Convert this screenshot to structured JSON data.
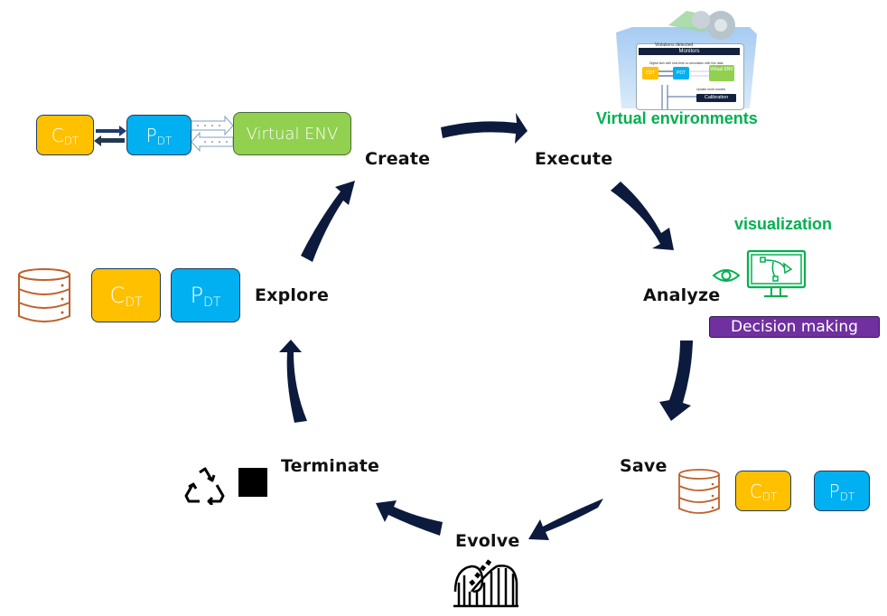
{
  "diagram": {
    "stages": {
      "create": "Create",
      "execute": "Execute",
      "analyze": "Analyze",
      "save": "Save",
      "evolve": "Evolve",
      "terminate": "Terminate",
      "explore": "Explore"
    },
    "create_group": {
      "c_dt": {
        "main": "C",
        "sub": "DT"
      },
      "p_dt": {
        "main": "P",
        "sub": "DT"
      },
      "virtual_env": "Virtual ENV"
    },
    "virtual_environments": {
      "title": "Virtual environments",
      "thumbnail": {
        "violations": "Violations detected",
        "monitors": "Monitors",
        "caption": "Digital twin with real-time co-simulation with live data",
        "c_dt": "CDT",
        "p_dt": "PDT",
        "virtual_env": "Virtual ENV",
        "update": "Update multi-models",
        "calibration": "Calibration"
      }
    },
    "analyze_group": {
      "visualization": "visualization",
      "decision_making": "Decision making"
    },
    "save_group": {
      "c_dt": {
        "main": "C",
        "sub": "DT"
      },
      "p_dt": {
        "main": "P",
        "sub": "DT"
      }
    },
    "explore_group": {
      "c_dt": {
        "main": "C",
        "sub": "DT"
      },
      "p_dt": {
        "main": "P",
        "sub": "DT"
      }
    },
    "colors": {
      "arrow": "#0c1a3d",
      "c_dt": "#ffc000",
      "p_dt": "#00b0f0",
      "virtual_env": "#92d050",
      "green_text": "#00b050",
      "decision": "#7030a0",
      "database": "#c0602a"
    }
  }
}
